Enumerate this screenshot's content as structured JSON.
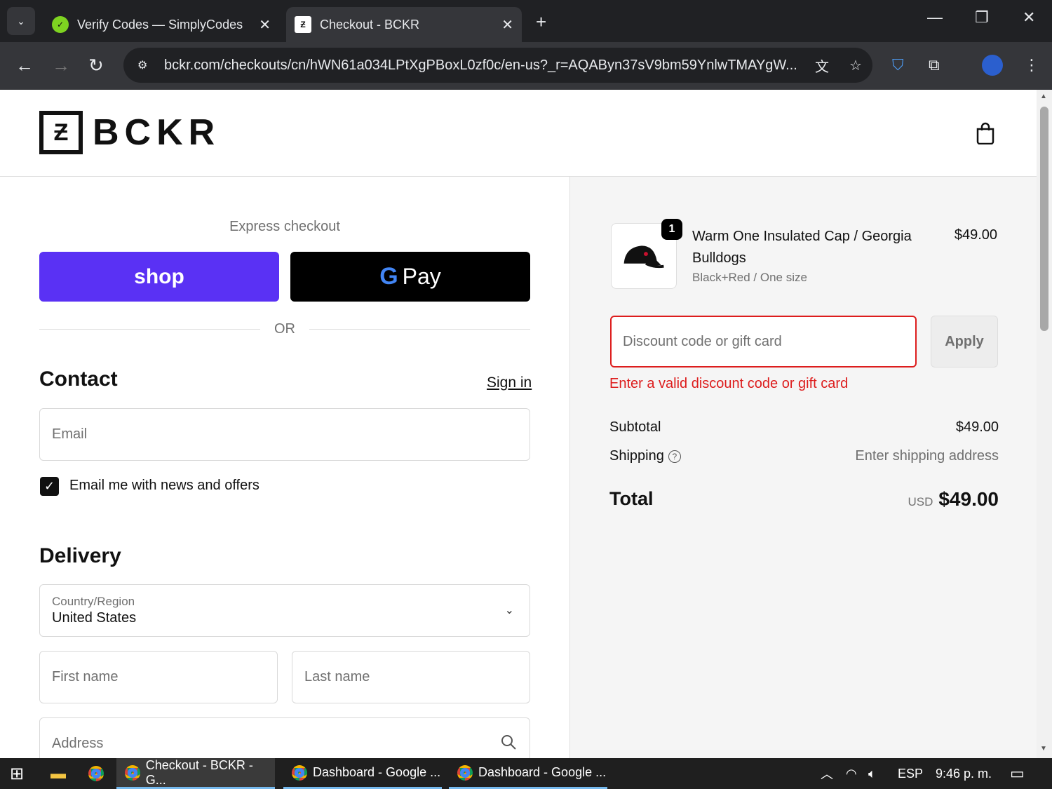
{
  "browser": {
    "tabs": [
      {
        "title": "Verify Codes — SimplyCodes",
        "active": false
      },
      {
        "title": "Checkout - BCKR",
        "active": true
      }
    ],
    "url": "bckr.com/checkouts/cn/hWN61a034LPtXgPBoxL0zf0c/en-us?_r=AQAByn37sV9bm59YnlwTMAYgW..."
  },
  "header": {
    "logo_text": "BCKR"
  },
  "express": {
    "label": "Express checkout",
    "shop_label": "shop",
    "gpay_label": "Pay",
    "or_label": "OR"
  },
  "contact": {
    "title": "Contact",
    "signin": "Sign in",
    "email_placeholder": "Email",
    "newsletter_label": "Email me with news and offers"
  },
  "delivery": {
    "title": "Delivery",
    "country_label": "Country/Region",
    "country_value": "United States",
    "first_name_placeholder": "First name",
    "last_name_placeholder": "Last name",
    "address_placeholder": "Address"
  },
  "order": {
    "quantity": "1",
    "product_name": "Warm One Insulated Cap / Georgia Bulldogs",
    "product_variant": "Black+Red / One size",
    "product_price": "$49.00",
    "discount_placeholder": "Discount code or gift card",
    "apply_label": "Apply",
    "error": "Enter a valid discount code or gift card",
    "subtotal_label": "Subtotal",
    "subtotal_value": "$49.00",
    "shipping_label": "Shipping",
    "shipping_value": "Enter shipping address",
    "total_label": "Total",
    "total_currency": "USD",
    "total_value": "$49.00"
  },
  "taskbar": {
    "apps": [
      "Checkout - BCKR - G...",
      "Dashboard - Google ...",
      "Dashboard - Google ..."
    ],
    "language": "ESP",
    "time": "9:46 p. m."
  },
  "colors": {
    "shop_purple": "#5a31f4",
    "error_red": "#dd1d1d"
  }
}
